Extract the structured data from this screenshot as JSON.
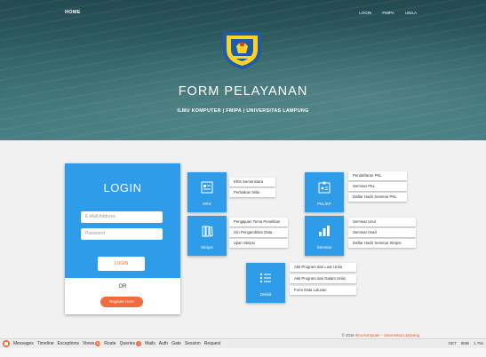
{
  "nav": {
    "home": "HOME",
    "links": [
      "LOGIN",
      "FMIPA",
      "UNILA"
    ]
  },
  "hero": {
    "title": "FORM PELAYANAN",
    "subtitle": "ILMU KOMPUTER | FMIPA | UNIVERSITAS LAMPUNG",
    "logo_text": "UNIVERSITAS LAMPUNG"
  },
  "login": {
    "title": "LOGIN",
    "email_placeholder": "E-Mail Address",
    "password_placeholder": "Password",
    "login_button": "LOGIN",
    "or": "OR",
    "register_button": "Register Here"
  },
  "tiles": {
    "krs": {
      "label": "KRS",
      "items": [
        "KRS Semenstara",
        "Perbaikan Nilai"
      ]
    },
    "pklkp": {
      "label": "PKL/KP",
      "items": [
        "Pendaftaran PKL",
        "Seminar PKL",
        "Daftar Hadir Seminar PKL"
      ]
    },
    "skripsi": {
      "label": "Skripsi",
      "items": [
        "Pengajuan Tema Penelitian",
        "Izin Pengambilan Data",
        "Ujian Skripsi"
      ]
    },
    "seminar": {
      "label": "Seminar",
      "items": [
        "Seminar Usul",
        "Seminar Hasil",
        "Daftar Hadir Seminar Skripsi"
      ]
    },
    "dekkit": {
      "label": "Dekkit",
      "items": [
        "Akti Program dari Luar Unila",
        "Akti Program dari Dalam Unila",
        "Form Data Lulusan"
      ]
    }
  },
  "footer": {
    "prefix": "© 2016",
    "link": "Ilmu Komputer",
    "suffix": "- Universitas Lampung"
  },
  "debugbar": {
    "tabs": [
      {
        "label": "Messages"
      },
      {
        "label": "Timeline"
      },
      {
        "label": "Exceptions"
      },
      {
        "label": "Views",
        "badge": "10"
      },
      {
        "label": "Route"
      },
      {
        "label": "Queries",
        "badge": "1"
      },
      {
        "label": "Mails"
      },
      {
        "label": "Auth"
      },
      {
        "label": "Gate"
      },
      {
        "label": "Session"
      },
      {
        "label": "Request"
      }
    ],
    "method": "GET",
    "memory": "8MB",
    "time": "1.78s"
  },
  "colors": {
    "primary": "#2f9ce9",
    "accent": "#f26a3d",
    "hero": "#2f6468"
  }
}
